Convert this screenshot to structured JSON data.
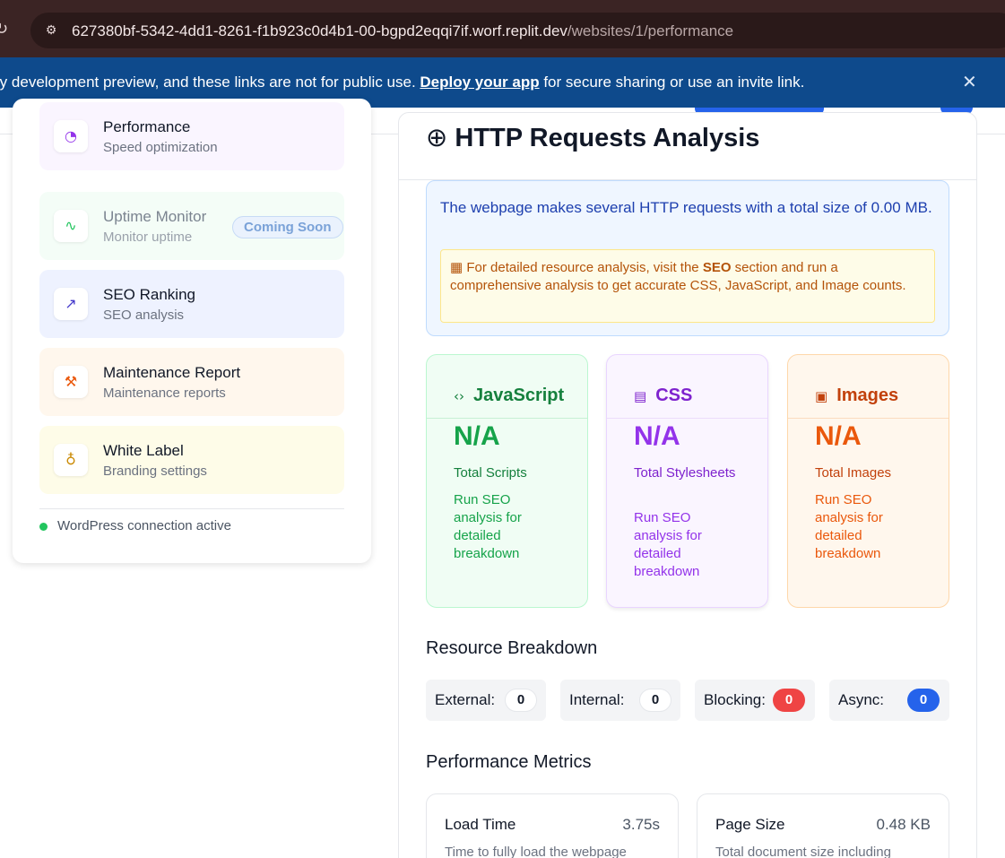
{
  "browser": {
    "url_host": "627380bf-5342-4dd1-8261-f1b923c0d4b1-00-bgpd2eqqi7if.worf.replit.dev",
    "url_path": "/websites/1/performance"
  },
  "banner": {
    "text_before": "porary development preview, and these links are not for public use. ",
    "link_text": "Deploy your app",
    "text_after": " for secure sharing or use an invite link."
  },
  "sidebar": {
    "items": [
      {
        "title": "Performance",
        "subtitle": "Speed optimization",
        "icon": "gauge-icon",
        "color": "#9333ea",
        "bg": "#faf5ff"
      },
      {
        "title": "Uptime Monitor",
        "subtitle": "Monitor uptime",
        "icon": "activity-icon",
        "color": "#22c55e",
        "bg": "#f4fdf7",
        "badge": "Coming Soon"
      },
      {
        "title": "SEO Ranking",
        "subtitle": "SEO analysis",
        "icon": "trending-up-icon",
        "color": "#4338ca",
        "bg": "#eef2ff"
      },
      {
        "title": "Maintenance Report",
        "subtitle": "Maintenance reports",
        "icon": "wrench-icon",
        "color": "#ea580c",
        "bg": "#fff7ed"
      },
      {
        "title": "White Label",
        "subtitle": "Branding settings",
        "icon": "award-icon",
        "color": "#ca8a04",
        "bg": "#fefce8"
      }
    ],
    "status": "WordPress connection active"
  },
  "main": {
    "title": "HTTP Requests Analysis",
    "summary": "The webpage makes several HTTP requests with a total size of 0.00 MB.",
    "note_prefix": "For detailed resource analysis, visit the ",
    "note_bold": "SEO",
    "note_suffix": " section and run a comprehensive analysis to get accurate CSS, JavaScript, and Image counts.",
    "resources": [
      {
        "title": "JavaScript",
        "value": "N/A",
        "label": "Total Scripts",
        "desc": "Run SEO analysis for detailed breakdown"
      },
      {
        "title": "CSS",
        "value": "N/A",
        "label": "Total Stylesheets",
        "desc": "Run SEO analysis for detailed breakdown"
      },
      {
        "title": "Images",
        "value": "N/A",
        "label": "Total Images",
        "desc": "Run SEO analysis for detailed breakdown"
      }
    ],
    "breakdown_title": "Resource Breakdown",
    "breakdown": [
      {
        "label": "External:",
        "count": "0"
      },
      {
        "label": "Internal:",
        "count": "0"
      },
      {
        "label": "Blocking:",
        "count": "0"
      },
      {
        "label": "Async:",
        "count": "0"
      }
    ],
    "metrics_title": "Performance Metrics",
    "metrics": [
      {
        "title": "Load Time",
        "value": "3.75s",
        "desc": "Time to fully load the webpage"
      },
      {
        "title": "Page Size",
        "value": "0.48 KB",
        "desc": "Total document size including"
      }
    ]
  }
}
